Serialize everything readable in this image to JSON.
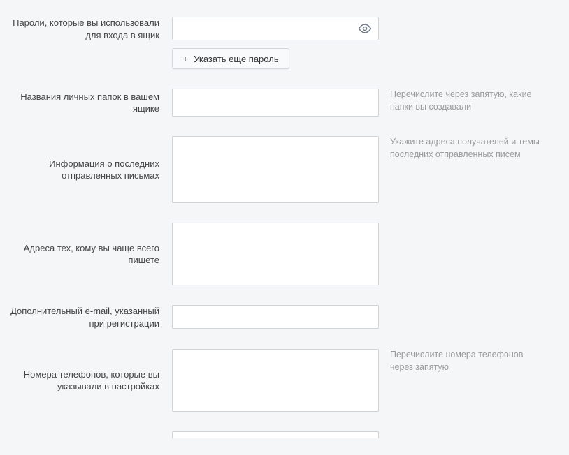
{
  "fields": {
    "passwords": {
      "label": "Пароли, которые вы использовали для входа в ящик",
      "value": "",
      "add_button": "Указать еще пароль"
    },
    "folders": {
      "label": "Названия личных папок в вашем ящике",
      "value": "",
      "hint": "Перечислите через запятую, какие папки вы создавали"
    },
    "sent_info": {
      "label": "Информация о последних отправленных письмах",
      "value": "",
      "hint": "Укажите адреса получателей и темы последних отправленных писем"
    },
    "frequent_addresses": {
      "label": "Адреса тех, кому вы чаще всего пишете",
      "value": ""
    },
    "secondary_email": {
      "label": "Дополнительный e-mail, указанный при регистрации",
      "value": ""
    },
    "phones": {
      "label": "Номера телефонов, которые вы указывали в настройках",
      "value": "",
      "hint": "Перечислите номера телефонов через запятую"
    }
  }
}
